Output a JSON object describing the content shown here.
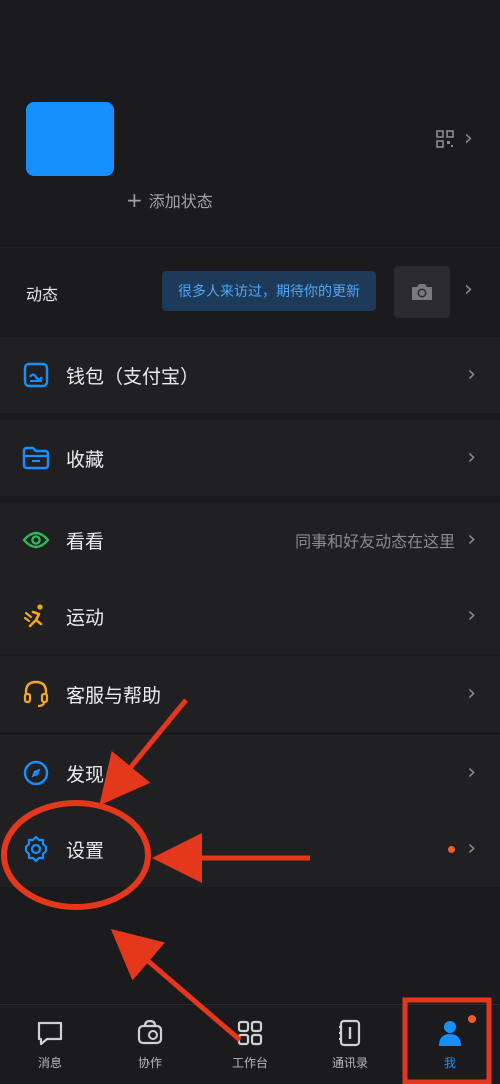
{
  "profile": {
    "add_status_label": "添加状态"
  },
  "dynamics": {
    "label": "动态",
    "tip": "很多人来访过，期待你的更新"
  },
  "menu": {
    "wallet": "钱包（支付宝）",
    "favorites": "收藏",
    "watch": "看看",
    "watch_hint": "同事和好友动态在这里",
    "sports": "运动",
    "support": "客服与帮助",
    "discover": "发现",
    "settings": "设置"
  },
  "nav": {
    "items": [
      "消息",
      "协作",
      "工作台",
      "通讯录",
      "我"
    ]
  },
  "colors": {
    "accent": "#1690ff",
    "annotation": "#e5371b",
    "green": "#2fb85a",
    "orange": "#f5a623"
  }
}
